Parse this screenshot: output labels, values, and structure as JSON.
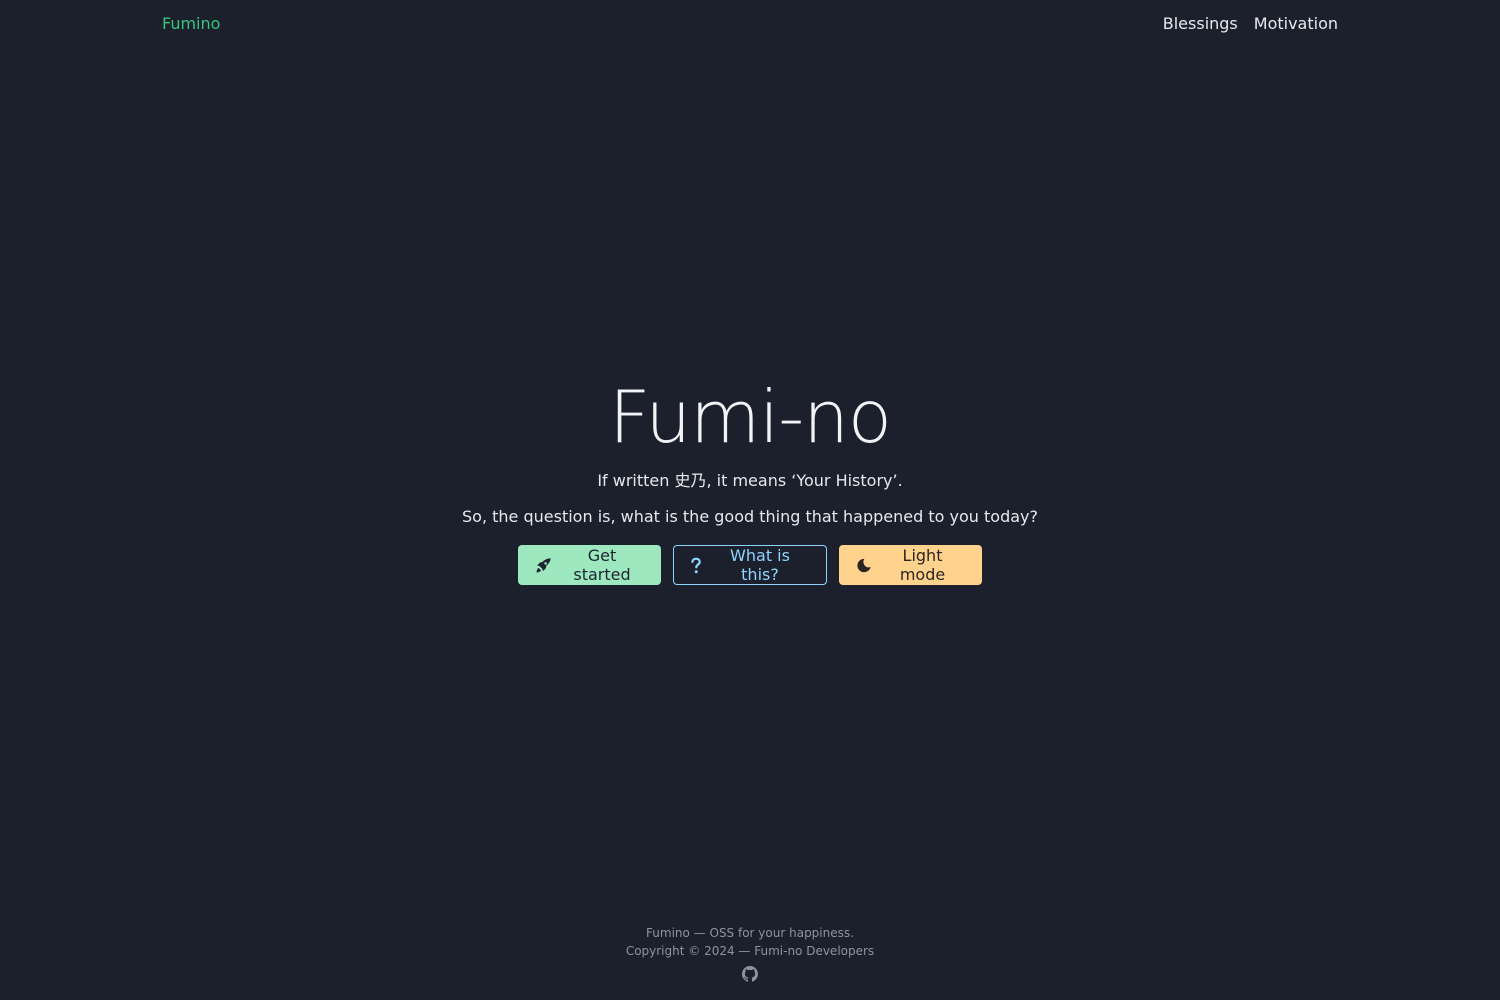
{
  "header": {
    "brand": "Fumino",
    "nav": [
      {
        "label": "Blessings"
      },
      {
        "label": "Motivation"
      }
    ]
  },
  "hero": {
    "title": "Fumi-no",
    "line1": "If written 史乃, it means ‘Your History’.",
    "line2": "So, the question is, what is the good thing that happened to you today?",
    "buttons": {
      "start": "Get started",
      "what": "What is this?",
      "light": "Light mode"
    }
  },
  "footer": {
    "tagline": "Fumino — OSS for your happiness.",
    "copyright": "Copyright © 2024 — Fumi-no Developers"
  },
  "icons": {
    "start": "rocket-icon",
    "what": "question-icon",
    "light": "moon-icon",
    "footer": "github-icon"
  },
  "colors": {
    "background": "#1c202c",
    "brand": "#35c47a",
    "start_button": "#9ee8bf",
    "what_button": "#8dd4ff",
    "light_button": "#ffd38e"
  }
}
